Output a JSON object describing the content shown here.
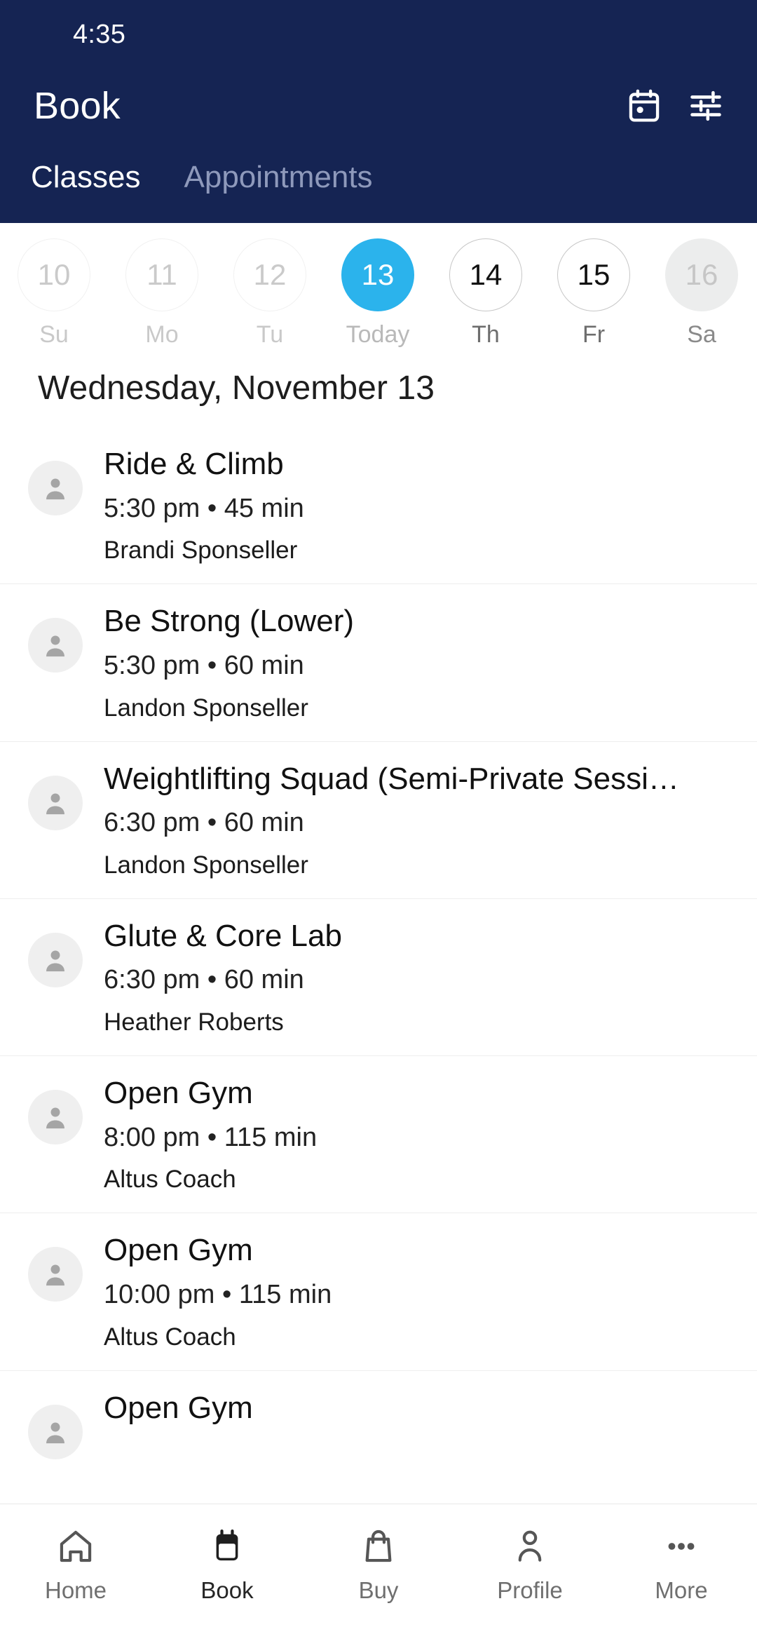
{
  "status_bar": {
    "clock": "4:35"
  },
  "app_bar": {
    "title": "Book",
    "calendar_icon": "calendar-icon",
    "filter_icon": "filter-sliders-icon"
  },
  "tabs": [
    {
      "label": "Classes",
      "active": true
    },
    {
      "label": "Appointments",
      "active": false
    }
  ],
  "date_strip": [
    {
      "day_number": "10",
      "day_label": "Su",
      "state": "disabled"
    },
    {
      "day_number": "11",
      "day_label": "Mo",
      "state": "disabled"
    },
    {
      "day_number": "12",
      "day_label": "Tu",
      "state": "disabled"
    },
    {
      "day_number": "13",
      "day_label": "Today",
      "state": "selected"
    },
    {
      "day_number": "14",
      "day_label": "Th",
      "state": "normal"
    },
    {
      "day_number": "15",
      "day_label": "Fr",
      "state": "normal"
    },
    {
      "day_number": "16",
      "day_label": "Sa",
      "state": "filled"
    }
  ],
  "schedule": {
    "day_heading": "Wednesday, November 13",
    "classes": [
      {
        "name": "Ride & Climb",
        "meta": "5:30 pm • 45 min",
        "coach": "Brandi Sponseller"
      },
      {
        "name": "Be Strong (Lower)",
        "meta": "5:30 pm • 60 min",
        "coach": "Landon Sponseller"
      },
      {
        "name": "Weightlifting Squad (Semi-Private Sessi…",
        "meta": "6:30 pm • 60 min",
        "coach": "Landon Sponseller"
      },
      {
        "name": "Glute & Core Lab",
        "meta": "6:30 pm • 60 min",
        "coach": "Heather Roberts"
      },
      {
        "name": "Open Gym",
        "meta": "8:00 pm • 115 min",
        "coach": "Altus Coach"
      },
      {
        "name": "Open Gym",
        "meta": "10:00 pm • 115 min",
        "coach": "Altus Coach"
      },
      {
        "name": "Open Gym",
        "meta": "",
        "coach": ""
      }
    ]
  },
  "bottom_nav": [
    {
      "label": "Home",
      "icon": "home-icon",
      "active": false
    },
    {
      "label": "Book",
      "icon": "calendar-icon",
      "active": true
    },
    {
      "label": "Buy",
      "icon": "shopping-bag-icon",
      "active": false
    },
    {
      "label": "Profile",
      "icon": "person-icon",
      "active": false
    },
    {
      "label": "More",
      "icon": "more-dots-icon",
      "active": false
    }
  ],
  "colors": {
    "header_navy": "#152453",
    "accent_blue": "#2BB3EC",
    "avatar_bg": "#efefef",
    "avatar_fg": "#a5a5a5"
  }
}
